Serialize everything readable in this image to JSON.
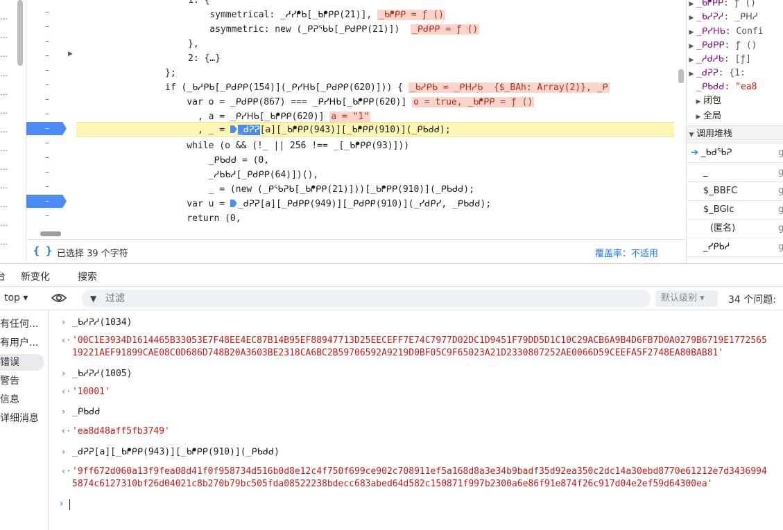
{
  "nav": {
    "stubs": [
      "…",
      "…",
      "…",
      "…",
      "…",
      "…",
      "…",
      "…",
      "…",
      "…",
      "…",
      "…",
      "…"
    ]
  },
  "gutter": {
    "marks": [
      "–",
      "–",
      "–",
      "–",
      "–",
      "–",
      "–",
      "–",
      "–",
      "–",
      "–",
      "–",
      "–",
      "–",
      "–",
      "–"
    ]
  },
  "code_lines": [
    {
      "text": "1: {"
    },
    {
      "text": "    symmetrical: _ᓱᓯᖰᑲ[_ᑲᖰᑭᑭ(21)],",
      "inline": "_ᑲᖰᑭᑭ = ƒ ()"
    },
    {
      "text": "    asymmetric: new (_ᑭᕈᖃᑲ[_ᑭᑯᑭᑭ(21)])",
      "inline": "_ᑭᑯᑭᑭ = ƒ ()"
    },
    {
      "text": "},"
    },
    {
      "text": "2: {…}"
    },
    {
      "text": "};"
    },
    {
      "text": "if (_ᑲᓱᑭᑲ[_ᑭᑯᑭᑭ(154)](_ᑭᓯᕼᑲ[_ᑭᑯᑭᑭ(620)])) {",
      "inline": "_ᑲᓱᑭᑲ = _ᑭᕼᓱᑲ  {$_BAh: Array(2)}, _ᑭ"
    },
    {
      "text": "    var o = _ᑭᑯᑭᑭ(867) === _ᑭᓯᕼᑲ[_ᑲᖰᑭᑭ(620)]",
      "inline": "o = true, _ᑲᖰᑭᑭ = ƒ ()"
    },
    {
      "text": "      , a = _ᑭᓯᕼᑲ[_ᑲᖰᑭᑭ(620)]",
      "inline": "a = \"1\""
    },
    {
      "text": "      , _ = ",
      "sel": "_ᑯᕈᕈ",
      "rest": "[a][_ᑲᖰᑭᑭ(943)][_ᑲᖰᑭᑭ(910)](_ᑭᑲᑯᑯ);"
    },
    {
      "text": "    while (o && (!_ || 256 !== _[_ᑲᖰᑭᑭ(93)]))"
    },
    {
      "text": "        _ᑭᑲᑯᑯ = (0,"
    },
    {
      "text": "        _ᓱᑲᑲᓱ[_ᑭᑯᑭᑭ(64)])(),"
    },
    {
      "text": "        _ = (new (_ᑭᖃᕈᑲ[_ᑲᖰᑭᑭ(21)]))[_ᑲᖰᑭᑭ(910)](_ᑭᑲᑯᑯ);"
    },
    {
      "text": "    var u = ",
      "rest": "_ᑯᕈᕈ[a][_ᑭᑯᑭᑭ(949)][_ᑭᑯᑭᑭ(910)](_ᓯᑯᑭᓯ, _ᑭᑲᑯᑯ);"
    },
    {
      "text": "    return (0,"
    }
  ],
  "statusbar": {
    "selection": "已选择 39 个字符",
    "coverage": "覆盖率：不适用"
  },
  "scope": {
    "items": [
      {
        "name": "_ᑲᖰᑭᑭ",
        "value": ": ƒ ()"
      },
      {
        "name": "_ᑲᓱᕈᓱ",
        "value": ": _ᑭᕼᓱ"
      },
      {
        "name": "_ᑭᓯᕼᑲ",
        "value": ": Confi"
      },
      {
        "name": "_ᑭᑯᑭᑭ",
        "value": ": ƒ ()"
      },
      {
        "name": "_ᓱᑯᓱᑲ",
        "value": ": [ƒ]"
      },
      {
        "name": "_ᑯᕈᕈ",
        "value": ": {1:"
      },
      {
        "name": "_ᑭᑲᑯᑯ",
        "value": ": \"ea8"
      }
    ],
    "closure": "闭包",
    "global": "全局",
    "callstack_header": "调用堆栈",
    "frames": [
      "_ᑲᑯᖃᕈ",
      "_",
      "$_BBFC",
      "$_BGIc",
      "(匿名)",
      "_ᓯᑭᑲᓱ"
    ]
  },
  "drawer_tabs": [
    "新变化",
    "搜索"
  ],
  "drawer_first_tab": "台",
  "toolbar": {
    "context": "top ▾",
    "filter_placeholder": "过滤",
    "level": "默认级别",
    "issues": "34 个问题:"
  },
  "left_list": [
    "有任何...",
    "有用户...",
    "错误",
    "警告",
    "信息",
    "详细消息"
  ],
  "console": [
    {
      "kind": "input",
      "text": "_ᑲᓱᕈᓱ(1034)"
    },
    {
      "kind": "result",
      "text": "'00C1E3934D1614465B33053E7F48EE4EC87B14B95EF88947713D25EECEFF7E74C7977D02DC1D9451F79DD5D1C10C29ACB6A9B4D6FB7D0A0279B6719E1772565",
      "text2": "19221AEF91899CAE08C0D686D748B20A3603BE2318CA6BC2B59706592A9219D0BF05C9F65023A21D2330807252AE0066D59CEEFA5F2748EA80BAB81'"
    },
    {
      "kind": "input",
      "text": "_ᑲᓱᕈᓱ(1005)"
    },
    {
      "kind": "result",
      "text": "'10001'"
    },
    {
      "kind": "input",
      "text": "_ᑭᑲᑯᑯ"
    },
    {
      "kind": "result",
      "text": "'ea8d48aff5fb3749'"
    },
    {
      "kind": "input",
      "text": "_ᑯᕈᕈ[a][_ᑲᖰᑭᑭ(943)][_ᑲᖰᑭᑭ(910)](_ᑭᑲᑯᑯ)"
    },
    {
      "kind": "result",
      "text": "'9ff672d060a13f9fea08d41f0f958734d516b0d8e12c4f750f699ce902c708911ef5a168d8a3e34b9badf35d92ea350c2dc14a30ebd8770e61212e7d3436994",
      "text2": "5874c6127310bf26d04021c8b270b79bc505fda08522238bdecc683abed64d582c150871f997b2300a6e86f91e874f26c917d04e2ef59d64300ea'"
    }
  ]
}
